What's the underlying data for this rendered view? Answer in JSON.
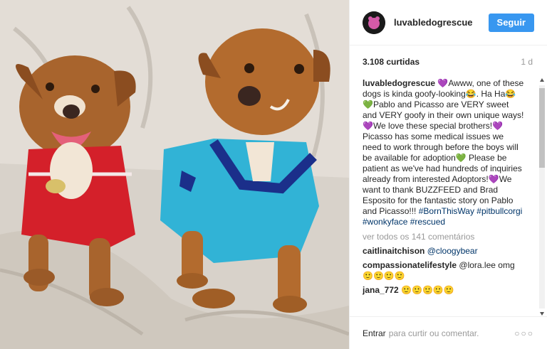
{
  "post": {
    "username": "luvabledogrescue",
    "follow_label": "Seguir",
    "likes": "3.108 curtidas",
    "time_ago": "1 d",
    "caption_user": "luvabledogrescue",
    "caption_lines": [
      "💜Awww, one of these dogs is kinda goofy-looking😂. Ha Ha😂💚Pablo and Picasso are VERY sweet and VERY goofy in their own unique ways!💜We love these special brothers!💜 Picasso has some medical issues we need to work through before the boys will be available for adoption💚 Please be patient as we've had hundreds of inquiries already from interested Adoptors!💜We want to thank BUZZFEED and Brad Esposito for the fantastic story on Pablo and Picasso!!!"
    ],
    "hashtags": "#BornThisWay #pitbullcorgi #wonkyface #rescued",
    "view_all": "ver todos os 141 comentários",
    "comments": [
      {
        "user": "caitlinaitchison",
        "text": "@cloogybear"
      },
      {
        "user": "compassionatelifestyle",
        "text": "@lora.lee omg 🙂🙂🙂🙂"
      },
      {
        "user": "jana_772",
        "text": "🙂🙂🙂🙂🙂"
      }
    ],
    "footer_enter": "Entrar",
    "footer_prompt": "para curtir ou comentar.",
    "more": "○○○"
  },
  "colors": {
    "accent": "#3897f0",
    "link": "#003569",
    "muted": "#999999"
  },
  "icons": [
    "avatar-dog-icon",
    "scroll-up-icon",
    "scroll-down-icon",
    "more-options-icon"
  ]
}
